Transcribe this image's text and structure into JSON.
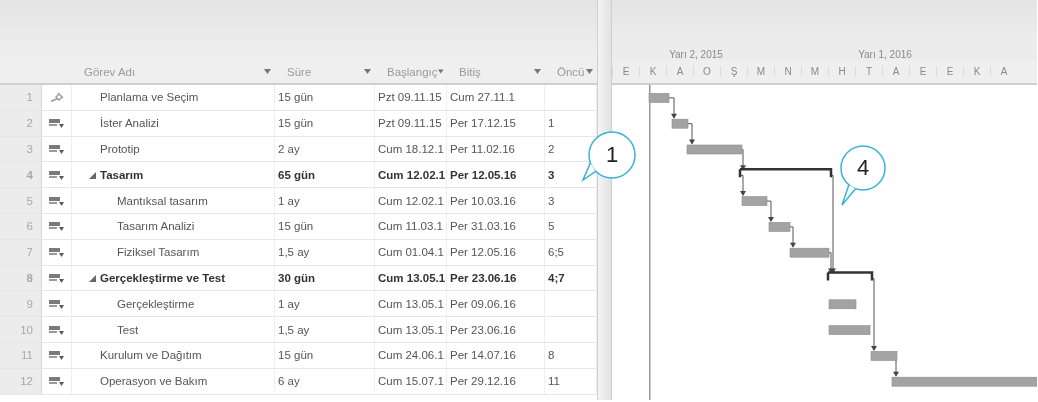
{
  "table": {
    "columns": [
      {
        "label": "Görev Adı"
      },
      {
        "label": "Süre"
      },
      {
        "label": "Başlangıç"
      },
      {
        "label": "Bitiş"
      },
      {
        "label": "Öncü"
      }
    ],
    "rows": [
      {
        "number": "1",
        "manually_scheduled": true,
        "kind": "task",
        "name": "Planlama ve Seçim",
        "duration": "15 gün",
        "start": "Pzt 09.11.15",
        "finish": "Cum 27.11.1"
      },
      {
        "number": "2",
        "manually_scheduled": false,
        "kind": "task",
        "name": "İster Analizi",
        "duration": "15 gün",
        "start": "Pzt 09.11.15",
        "finish": "Per 17.12.15",
        "predecessors": "1"
      },
      {
        "number": "3",
        "manually_scheduled": false,
        "kind": "task",
        "name": "Prototip",
        "duration": "2 ay",
        "start": "Cum 18.12.1",
        "finish": "Per 11.02.16",
        "predecessors": "2"
      },
      {
        "number": "4",
        "manually_scheduled": false,
        "kind": "summary",
        "expanded": true,
        "name": "Tasarım",
        "duration": "65 gün",
        "start": "Cum 12.02.1",
        "finish": "Per 12.05.16",
        "predecessors": "3",
        "children": [
          {
            "number": "5",
            "manually_scheduled": false,
            "kind": "task",
            "name": "Mantıksal tasarım",
            "duration": "1 ay",
            "start": "Cum 12.02.1",
            "finish": "Per 10.03.16",
            "predecessors": "3"
          },
          {
            "number": "6",
            "manually_scheduled": false,
            "kind": "task",
            "name": "Tasarım Analizi",
            "duration": "15 gün",
            "start": "Cum 11.03.1",
            "finish": "Per 31.03.16",
            "predecessors": "5"
          },
          {
            "number": "7",
            "manually_scheduled": false,
            "kind": "task",
            "name": "Fiziksel Tasarım",
            "duration": "1,5 ay",
            "start": "Cum 01.04.1",
            "finish": "Per 12.05.16",
            "predecessors": "6;5"
          }
        ]
      },
      {
        "number": "8",
        "manually_scheduled": false,
        "kind": "summary",
        "expanded": true,
        "name": "Gerçekleştirme ve Test",
        "duration": "30 gün",
        "start": "Cum 13.05.1",
        "finish": "Per 23.06.16",
        "predecessors": "4;7",
        "children": [
          {
            "number": "9",
            "manually_scheduled": false,
            "kind": "task",
            "name": "Gerçekleştirme",
            "duration": "1 ay",
            "start": "Cum 13.05.1",
            "finish": "Per 09.06.16"
          },
          {
            "number": "10",
            "manually_scheduled": false,
            "kind": "task",
            "name": "Test",
            "duration": "1,5 ay",
            "start": "Cum 13.05.1",
            "finish": "Per 23.06.16"
          }
        ]
      },
      {
        "number": "11",
        "manually_scheduled": false,
        "kind": "task",
        "name": "Kurulum ve Dağıtım",
        "duration": "15 gün",
        "start": "Cum 24.06.1",
        "finish": "Per 14.07.16",
        "predecessors": "8"
      },
      {
        "number": "12",
        "manually_scheduled": false,
        "kind": "task",
        "name": "Operasyon ve Bakım",
        "duration": "6 ay",
        "start": "Cum 15.07.1",
        "finish": "Per 29.12.16",
        "predecessors": "11"
      }
    ]
  },
  "gantt": {
    "timescale_top": [
      "Yarı 2, 2015",
      "Yarı 1, 2016"
    ],
    "timescale_bottom": [
      "E",
      "K",
      "A",
      "O",
      "Ş",
      "M",
      "N",
      "M",
      "H",
      "T",
      "A",
      "E",
      "E",
      "K",
      "A"
    ]
  },
  "callouts": [
    {
      "label": "1"
    },
    {
      "label": "4"
    }
  ]
}
